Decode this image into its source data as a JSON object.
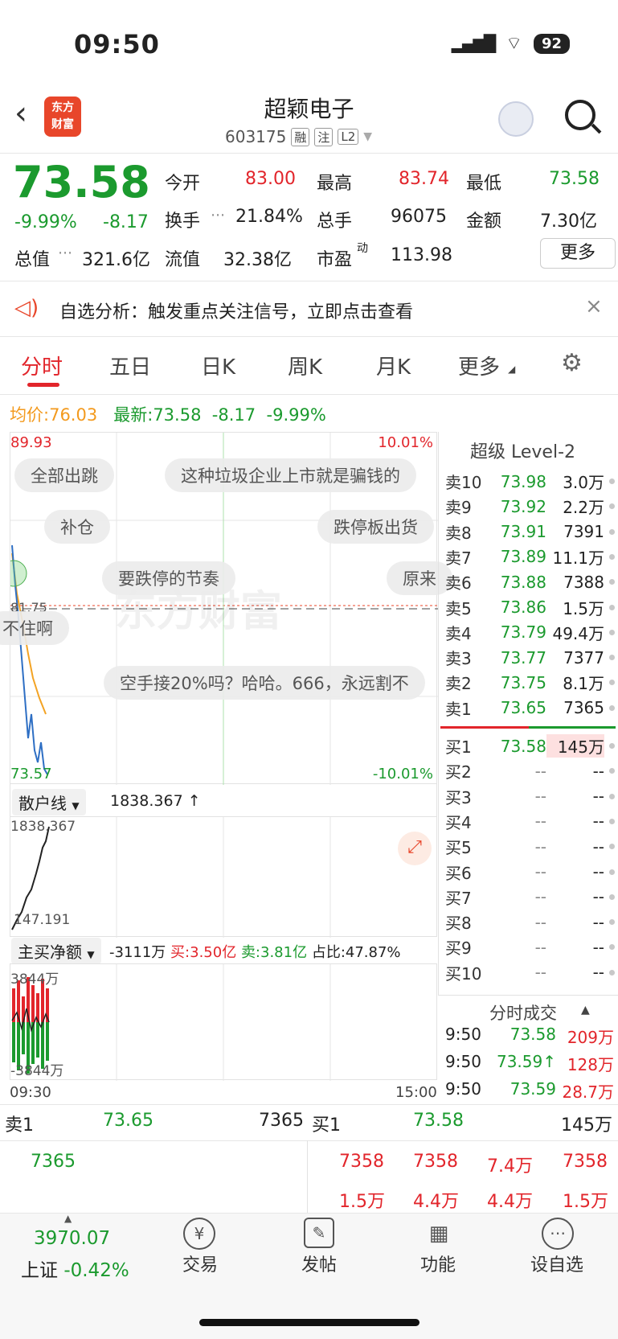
{
  "status": {
    "time": "09:50",
    "battery": "92"
  },
  "header": {
    "title": "超颖电子",
    "code": "603175",
    "tags": [
      "融",
      "注",
      "L2"
    ],
    "logo_line1": "东方",
    "logo_line2": "财富"
  },
  "quote": {
    "price": "73.58",
    "pct": "-9.99%",
    "chg": "-8.17",
    "open_label": "今开",
    "open": "83.00",
    "high_label": "最高",
    "high": "83.74",
    "low_label": "最低",
    "low": "73.58",
    "turnover_label": "换手",
    "turnover": "21.84%",
    "vol_label": "总手",
    "vol": "96075",
    "amount_label": "金额",
    "amount": "7.30亿",
    "mcap_label": "总值",
    "mcap": "321.6亿",
    "float_label": "流值",
    "float": "32.38亿",
    "pe_label": "市盈",
    "pe_sup": "动",
    "pe": "113.98",
    "more": "更多"
  },
  "alert": {
    "text": "自选分析：触发重点关注信号，立即点击查看"
  },
  "tabs": [
    "分时",
    "五日",
    "日K",
    "周K",
    "月K",
    "更多"
  ],
  "avg": {
    "label": "均价:",
    "value": "76.03",
    "latest_label": "最新:",
    "latest": "73.58",
    "chg": "-8.17",
    "pct": "-9.99%"
  },
  "chart": {
    "top": "89.93",
    "top_pct": "10.01%",
    "mid": "81.75",
    "bottom": "73.57",
    "bottom_pct": "-10.01%",
    "watermark": "东方财富"
  },
  "bubbles": [
    "全部出跳",
    "这种垃圾企业上市就是骗钱的",
    "补仓",
    "跌停板出货",
    "要跌停的节奏",
    "原来",
    "不住啊",
    "空手接20%吗？哈哈。666，永远割不"
  ],
  "retail": {
    "label": "散户线",
    "value": "1838.367",
    "arrow": "↑",
    "max": "1838.367",
    "min": "147.191"
  },
  "netbuy": {
    "label": "主买净额",
    "value": "-3111万",
    "buy": "买:3.50亿",
    "sell": "卖:3.81亿",
    "ratio": "占比:47.87%",
    "max": "3844万",
    "min": "-3844万"
  },
  "time_axis": {
    "start": "09:30",
    "end": "15:00"
  },
  "orderbook": {
    "title": "超级 Level-2",
    "asks": [
      [
        "卖10",
        "73.98",
        "3.0万"
      ],
      [
        "卖9",
        "73.92",
        "2.2万"
      ],
      [
        "卖8",
        "73.91",
        "7391"
      ],
      [
        "卖7",
        "73.89",
        "11.1万"
      ],
      [
        "卖6",
        "73.88",
        "7388"
      ],
      [
        "卖5",
        "73.86",
        "1.5万"
      ],
      [
        "卖4",
        "73.79",
        "49.4万"
      ],
      [
        "卖3",
        "73.77",
        "7377"
      ],
      [
        "卖2",
        "73.75",
        "8.1万"
      ],
      [
        "卖1",
        "73.65",
        "7365"
      ]
    ],
    "bids": [
      [
        "买1",
        "73.58",
        "145万"
      ],
      [
        "买2",
        "--",
        "--"
      ],
      [
        "买3",
        "--",
        "--"
      ],
      [
        "买4",
        "--",
        "--"
      ],
      [
        "买5",
        "--",
        "--"
      ],
      [
        "买6",
        "--",
        "--"
      ],
      [
        "买7",
        "--",
        "--"
      ],
      [
        "买8",
        "--",
        "--"
      ],
      [
        "买9",
        "--",
        "--"
      ],
      [
        "买10",
        "--",
        "--"
      ]
    ]
  },
  "trades": {
    "title": "分时成交",
    "rows": [
      [
        "9:50",
        "73.58",
        "209万"
      ],
      [
        "9:50",
        "73.59↑",
        "128万"
      ],
      [
        "9:50",
        "73.59",
        "28.7万"
      ]
    ]
  },
  "queue": {
    "sell_label": "卖1",
    "sell_price": "73.65",
    "sell_vol": "7365",
    "buy_label": "买1",
    "buy_price": "73.58",
    "buy_vol": "145万",
    "sell_items": [
      "7365"
    ],
    "buy_items": [
      "7358",
      "7358",
      "7.4万",
      "7358",
      "1.5万",
      "4.4万",
      "4.4万",
      "1.5万"
    ]
  },
  "bottom": {
    "index": "3970.07",
    "index_name": "上证",
    "index_pct": "-0.42%",
    "items": [
      "交易",
      "发帖",
      "功能",
      "设自选"
    ]
  }
}
